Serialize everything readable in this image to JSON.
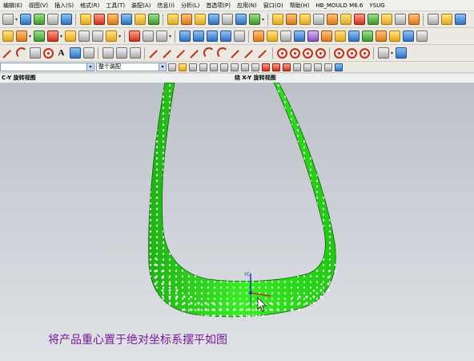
{
  "menu": {
    "items": [
      "编辑(E)",
      "视图(V)",
      "插入(S)",
      "格式(R)",
      "工具(T)",
      "装配(A)",
      "信息(I)",
      "分析(L)",
      "首选项(P)",
      "应用(N)",
      "窗口(O)",
      "帮助(H)"
    ],
    "extras": [
      "HB_MOULD M6.6",
      "YSUG"
    ]
  },
  "selection_bar": {
    "filter_value": "",
    "scope_value": "整个装配"
  },
  "viewports": {
    "left_label": "C-Y 旋转视图",
    "right_label": "绕 X-Y 旋转视图"
  },
  "model": {
    "color": "#2fe81f",
    "csys_label": "YC"
  },
  "caption": "将产品重心置于绝对坐标系摆平如图"
}
